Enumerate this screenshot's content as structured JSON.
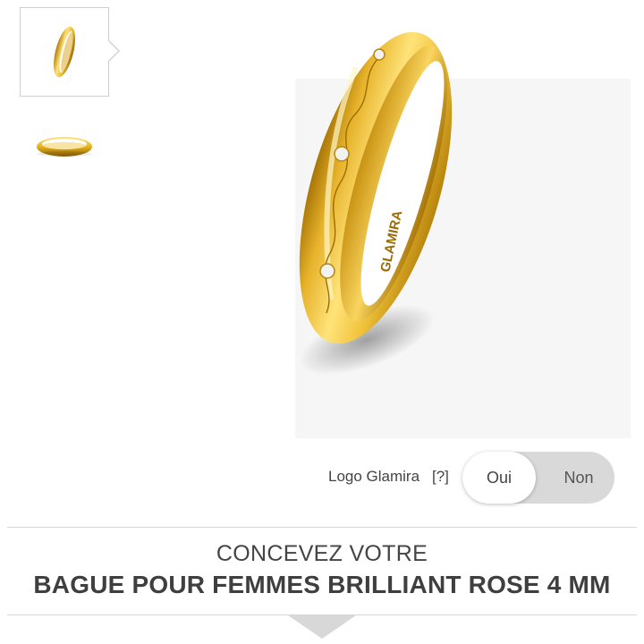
{
  "gallery": {
    "thumbnails": [
      {
        "name": "ring-front-view",
        "selected": true
      },
      {
        "name": "ring-side-view",
        "selected": false
      }
    ],
    "main_image": {
      "engraving": "GLAMIRA",
      "metal_color": "#e8b520"
    }
  },
  "logo_option": {
    "label": "Logo Glamira",
    "help": "[?]",
    "options": [
      "Oui",
      "Non"
    ],
    "selected": "Oui"
  },
  "product": {
    "subtitle": "CONCEVEZ VOTRE",
    "title": "BAGUE POUR FEMMES BRILLIANT ROSE 4 MM"
  }
}
